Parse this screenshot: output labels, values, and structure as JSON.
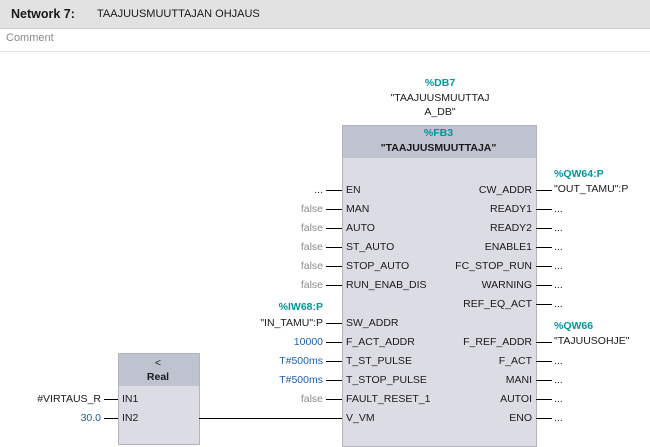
{
  "network": {
    "label": "Network 7:",
    "title": "TAAJUUSMUUTTAJAN OHJAUS",
    "comment_placeholder": "Comment"
  },
  "fb": {
    "db_addr": "%DB7",
    "db_name_line1": "\"TAAJUUSMUUTTAJ",
    "db_name_line2": "A_DB\"",
    "fb_addr": "%FB3",
    "fb_name": "\"TAAJUUSMUUTTAJA\"",
    "inputs": [
      {
        "pin": "EN",
        "value": "..."
      },
      {
        "pin": "MAN",
        "value": "false"
      },
      {
        "pin": "AUTO",
        "value": "false"
      },
      {
        "pin": "ST_AUTO",
        "value": "false"
      },
      {
        "pin": "STOP_AUTO",
        "value": "false"
      },
      {
        "pin": "RUN_ENAB_DIS",
        "value": "false"
      },
      {
        "pin": "SW_ADDR",
        "value": "\"IN_TAMU\":P",
        "addr": "%IW68:P"
      },
      {
        "pin": "F_ACT_ADDR",
        "value": "10000"
      },
      {
        "pin": "T_ST_PULSE",
        "value": "T#500ms"
      },
      {
        "pin": "T_STOP_PULSE",
        "value": "T#500ms"
      },
      {
        "pin": "FAULT_RESET_1",
        "value": "false"
      },
      {
        "pin": "V_VM",
        "value": ""
      }
    ],
    "outputs": [
      {
        "pin": "CW_ADDR",
        "value": "\"OUT_TAMU\":P",
        "addr": "%QW64:P"
      },
      {
        "pin": "READY1",
        "value": "..."
      },
      {
        "pin": "READY2",
        "value": "..."
      },
      {
        "pin": "ENABLE1",
        "value": "..."
      },
      {
        "pin": "FC_STOP_RUN",
        "value": "..."
      },
      {
        "pin": "WARNING",
        "value": "..."
      },
      {
        "pin": "REF_EQ_ACT",
        "value": "..."
      },
      {
        "pin": "",
        "value": ""
      },
      {
        "pin": "F_REF_ADDR",
        "value": "\"TAJUUSOHJE\"",
        "addr": "%QW66"
      },
      {
        "pin": "F_ACT",
        "value": "..."
      },
      {
        "pin": "MANI",
        "value": "..."
      },
      {
        "pin": "AUTOI",
        "value": "..."
      },
      {
        "pin": "ENO",
        "value": "..."
      }
    ]
  },
  "cmp": {
    "op": "<",
    "type": "Real",
    "in1_pin": "IN1",
    "in1_value": "#VIRTAUS_R",
    "in2_pin": "IN2",
    "in2_value": "30.0"
  }
}
